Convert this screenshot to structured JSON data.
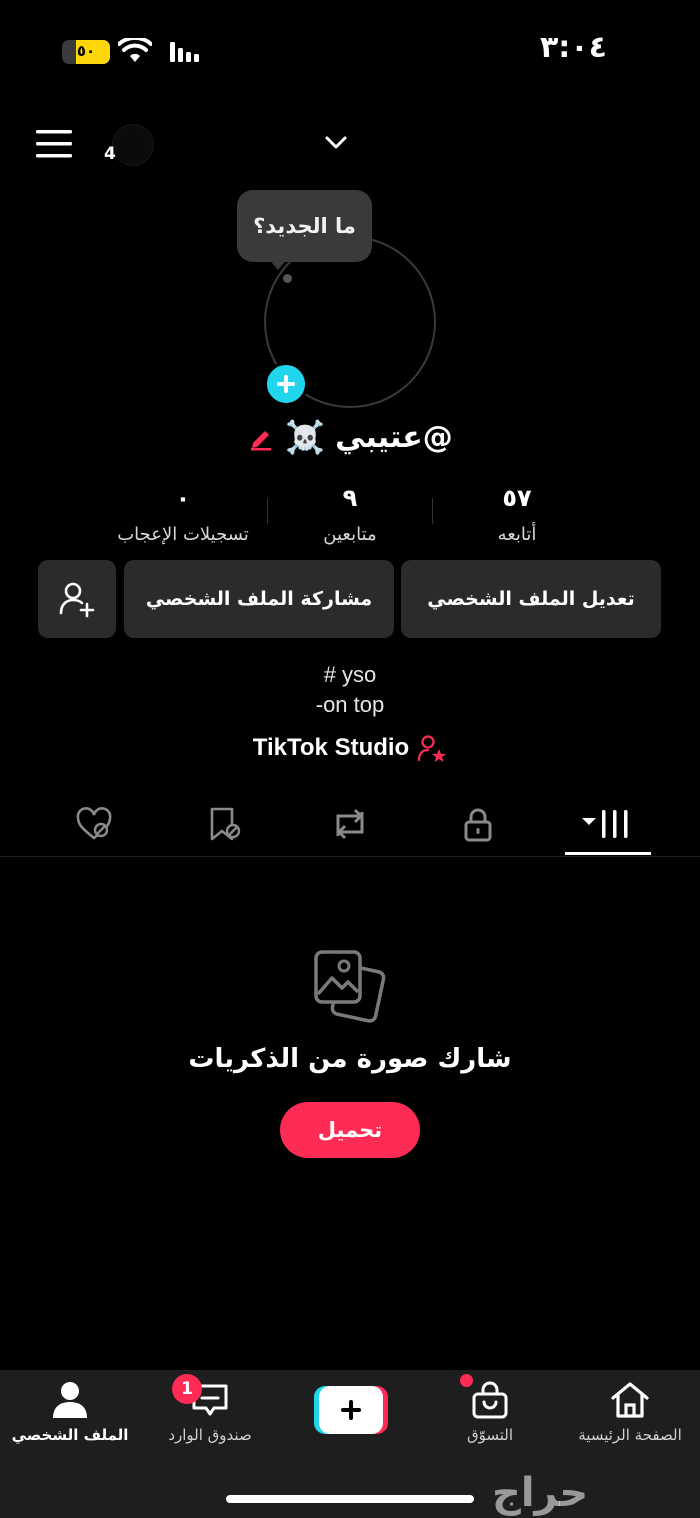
{
  "status_bar": {
    "time": "٣:٠٤",
    "battery_level": "٥٠",
    "battery_color": "#ffd60a"
  },
  "header": {
    "notification_count": "4",
    "menu_icon": "hamburger-menu-icon",
    "dropdown_icon": "chevron-down-icon"
  },
  "profile": {
    "bubble_text": "ما الجديد؟",
    "username": "@عتيبي",
    "username_emoji": "☠️",
    "stats": [
      {
        "value": "٥٧",
        "label": "أتابعه"
      },
      {
        "value": "٩",
        "label": "متابعين"
      },
      {
        "value": "٠",
        "label": "تسجيلات الإعجاب"
      }
    ],
    "buttons": {
      "edit": "تعديل الملف الشخصي",
      "share": "مشاركة الملف الشخصي"
    },
    "bio_line1": "# yso",
    "bio_line2": "-on top",
    "studio_link": "TikTok Studio"
  },
  "tabs": [
    {
      "icon": "videos-grid-icon",
      "active": true
    },
    {
      "icon": "lock-icon",
      "active": false
    },
    {
      "icon": "repost-icon",
      "active": false
    },
    {
      "icon": "bookmark-icon",
      "active": false
    },
    {
      "icon": "liked-hidden-icon",
      "active": false
    }
  ],
  "empty_state": {
    "icon": "photos-icon",
    "title": "شارك صورة من الذكريات",
    "button": "تحميل"
  },
  "bottom_nav": {
    "home": "الصفحة الرئيسية",
    "shop": "التسوّق",
    "inbox": "صندوق الوارد",
    "inbox_badge": "1",
    "profile": "الملف الشخصي"
  },
  "colors": {
    "accent": "#fe2c55",
    "cyan": "#20d5ec",
    "background": "#000000",
    "button_bg": "#2b2b2b"
  },
  "watermark": "حراج"
}
